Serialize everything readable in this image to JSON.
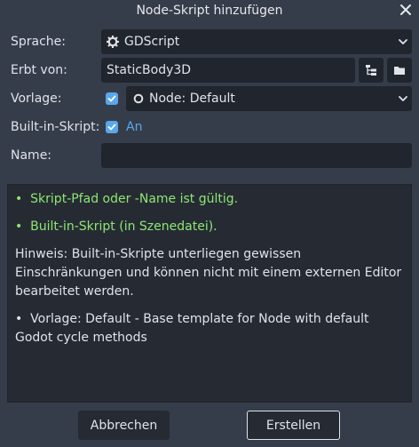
{
  "window": {
    "title": "Node-Skript hinzufügen"
  },
  "form": {
    "language": {
      "label": "Sprache:",
      "value": "GDScript"
    },
    "inherits": {
      "label": "Erbt von:",
      "value": "StaticBody3D"
    },
    "template": {
      "label": "Vorlage:",
      "checked": true,
      "value": "Node: Default"
    },
    "builtin": {
      "label": "Built-in-Skript:",
      "checked": true,
      "state_text": "An"
    },
    "name": {
      "label": "Name:",
      "value": ""
    }
  },
  "info": {
    "bullet": "•",
    "line1": "Skript-Pfad oder -Name ist gültig.",
    "line2": "Built-in-Skript (in Szenedatei).",
    "line3": "Hinweis: Built-in-Skripte unterliegen gewissen Einschränkungen und können nicht mit einem externen Editor bearbeitet werden.",
    "line4": "Vorlage: Default - Base template for Node with default Godot cycle methods"
  },
  "buttons": {
    "cancel": "Abbrechen",
    "create": "Erstellen"
  },
  "colors": {
    "background": "#363d4a",
    "field": "#20252e",
    "accent": "#5aa7ea",
    "success": "#8ee675",
    "panel": "#262b33"
  }
}
